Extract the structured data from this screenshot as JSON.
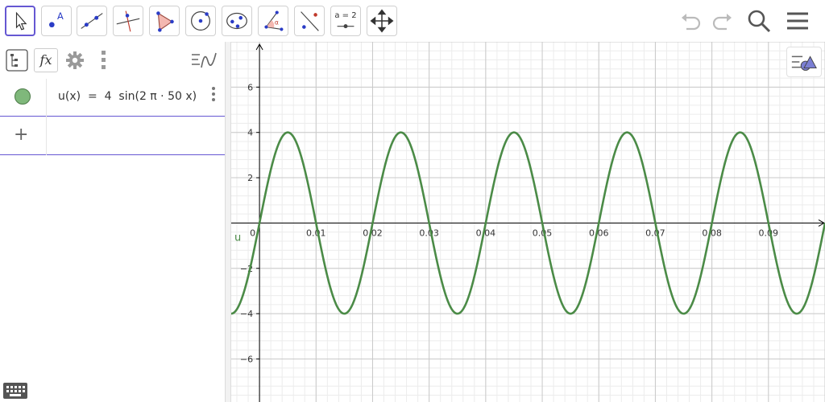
{
  "toolbar": {
    "tools": [
      {
        "name": "move-tool-button",
        "icon": "cursor-icon",
        "active": true
      },
      {
        "name": "point-tool-button",
        "icon": "point-icon"
      },
      {
        "name": "line-tool-button",
        "icon": "line-icon"
      },
      {
        "name": "perpendicular-tool-button",
        "icon": "perpendicular-line-icon"
      },
      {
        "name": "polygon-tool-button",
        "icon": "polygon-icon"
      },
      {
        "name": "circle-tool-button",
        "icon": "circle-icon"
      },
      {
        "name": "conic-tool-button",
        "icon": "ellipse-icon"
      },
      {
        "name": "angle-tool-button",
        "icon": "angle-icon"
      },
      {
        "name": "reflect-tool-button",
        "icon": "reflect-icon"
      },
      {
        "name": "slider-tool-button",
        "icon": "slider-icon",
        "label": "a = 2"
      },
      {
        "name": "move-view-tool-button",
        "icon": "move-arrows-icon"
      }
    ],
    "right": [
      "undo-icon",
      "redo-icon",
      "search-icon",
      "menu-icon"
    ]
  },
  "algebra": {
    "header_buttons": [
      "tree-view-icon",
      "fx-icon",
      "settings-icon",
      "more-vert-icon"
    ],
    "fx_label": "fx",
    "functions": [
      {
        "expression": "u(x)  =  4  sin(2 π · 50 x)",
        "color": "#4b8b47"
      }
    ],
    "input_plus": "+"
  },
  "graphics": {
    "curve_color": "#4b8b47",
    "axis_color": "#000000",
    "grid_major": "#c9c9c9",
    "grid_minor": "#ececec",
    "curve_label": "u"
  },
  "chart_data": {
    "type": "line",
    "title": "",
    "series": [
      {
        "name": "u",
        "function": "4 sin(2π·50x)",
        "amplitude": 4,
        "frequency": 50
      }
    ],
    "xlabel": "",
    "ylabel": "",
    "xlim": [
      -0.005,
      0.1
    ],
    "ylim": [
      -7.9,
      8.0
    ],
    "x_ticks": [
      "0",
      "0.01",
      "0.02",
      "0.03",
      "0.04",
      "0.05",
      "0.06",
      "0.07",
      "0.08",
      "0.09"
    ],
    "y_ticks": [
      "6",
      "4",
      "2",
      "−2",
      "−4",
      "−6"
    ],
    "grid": true
  }
}
